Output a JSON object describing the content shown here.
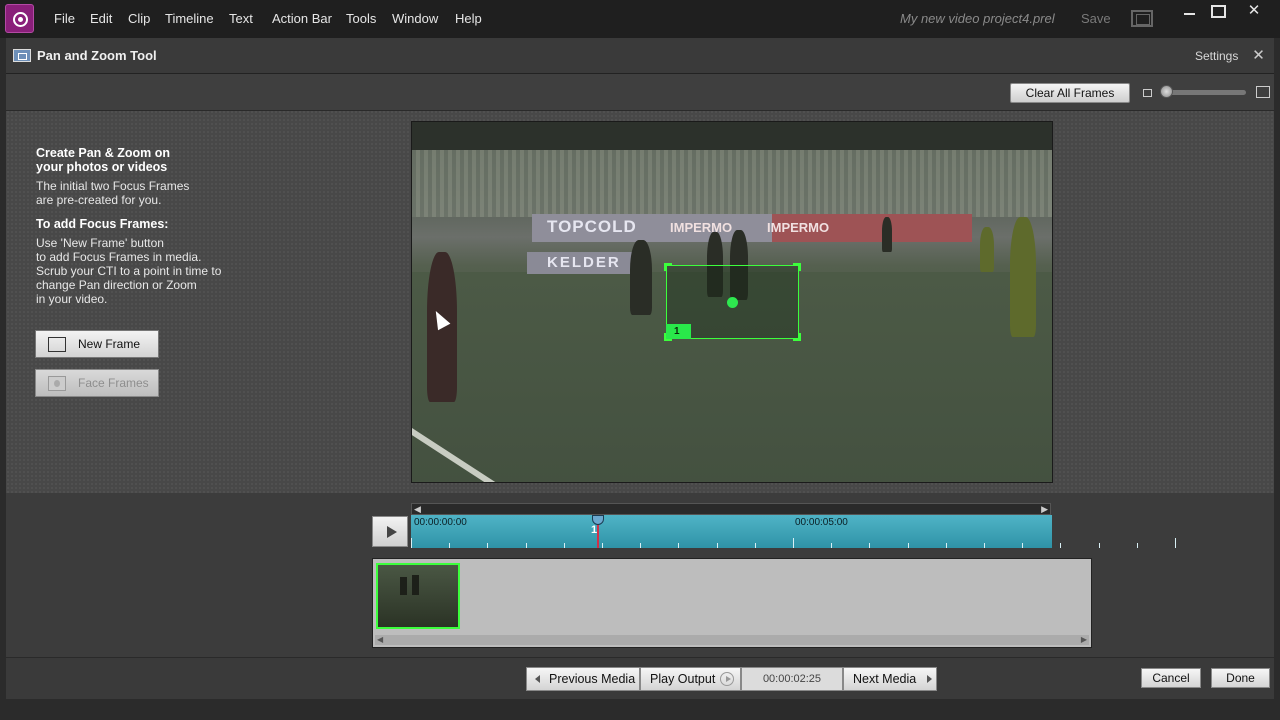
{
  "menu": [
    "File",
    "Edit",
    "Clip",
    "Timeline",
    "Text",
    "Action Bar",
    "Tools",
    "Window",
    "Help"
  ],
  "titlebar": {
    "project_name": "My new video project4.prel",
    "save_label": "Save",
    "close_glyph": "✕"
  },
  "panel": {
    "title": "Pan and Zoom Tool",
    "settings_label": "Settings",
    "close_glyph": "✕"
  },
  "toolbar": {
    "clear_all_frames": "Clear All Frames"
  },
  "instructions": {
    "heading_1": "Create Pan & Zoom on",
    "heading_2": "your photos or videos",
    "intro_1": "The initial two Focus Frames",
    "intro_2": "are pre-created for you.",
    "add_heading": "To add Focus Frames:",
    "steps": [
      "Use 'New Frame' button",
      "to add Focus Frames in media.",
      "Scrub your CTI to a point in time to",
      "change Pan direction or Zoom",
      "in your video."
    ]
  },
  "buttons": {
    "new_frame": "New Frame",
    "face_frames": "Face Frames"
  },
  "preview": {
    "ad_topcold": "TOPCOLD",
    "ad_impermo_1": "IMPERMO",
    "ad_impermo_2": "IMPERMO",
    "ad_kelder": "KELDER",
    "focus_frame_label": "1"
  },
  "timeline": {
    "start_time": "00:00:00:00",
    "mid_time": "00:00:05:00",
    "cti_label": "1",
    "scroll_left": "◀",
    "scroll_right": "▶",
    "thumb_scroll_left": "◀",
    "thumb_scroll_right": "▶"
  },
  "bottom": {
    "previous_media": "Previous Media",
    "play_output": "Play Output",
    "timecode": "00:00:02:25",
    "next_media": "Next Media",
    "cancel": "Cancel",
    "done": "Done"
  },
  "colors": {
    "focus_frame": "#3cff3c",
    "ruler": "#3fa3b7",
    "cti": "#d1304a",
    "app_logo": "#8a1f7a"
  }
}
